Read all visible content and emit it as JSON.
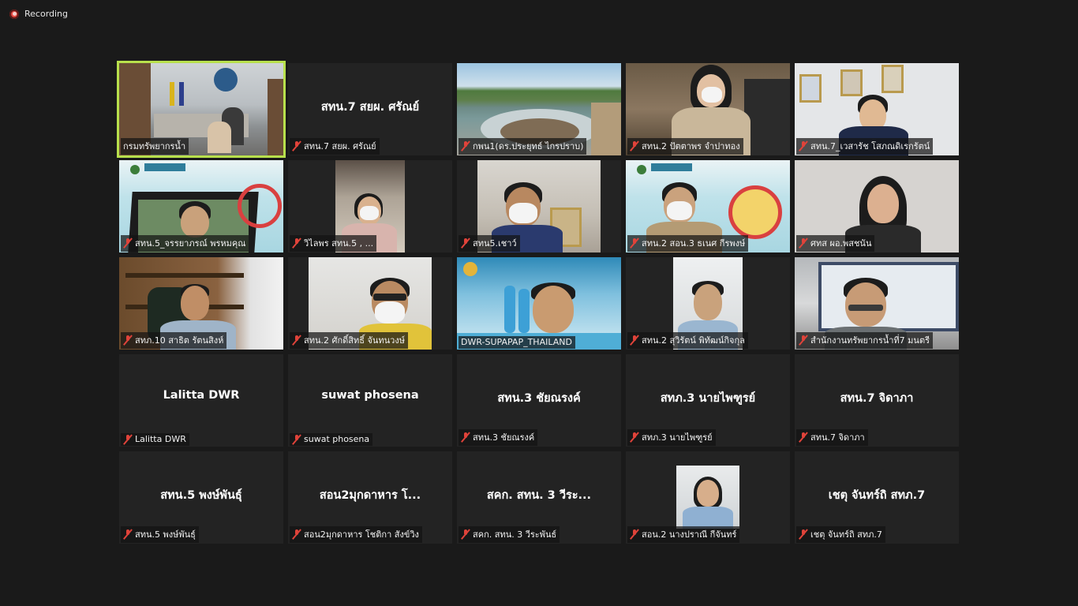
{
  "recording": {
    "label": "Recording"
  },
  "participants": [
    {
      "name": "กรมทรัพยากรน้ำ",
      "display": "",
      "video": true,
      "muted": false,
      "active": true
    },
    {
      "name": "สทน.7 สยผ. ศรัณย์",
      "display": "สทน.7 สยผ. ศรัณย์",
      "video": false,
      "muted": true
    },
    {
      "name": "กพน1(ดร.ประยุทธ์  ไกรปราบ)",
      "display": "",
      "video": true,
      "muted": true
    },
    {
      "name": "สทน.2 ปัตตาพร  จำปาทอง",
      "display": "",
      "video": true,
      "muted": true
    },
    {
      "name": "สทน.7_เวสารัช โสภณดิเรกรัตน์",
      "display": "",
      "video": true,
      "muted": true
    },
    {
      "name": "สทน.5_จรรยาภรณ์ พรหมคุณ",
      "display": "",
      "video": true,
      "muted": true
    },
    {
      "name": "วิไลพร สทน.5 , ...",
      "display": "",
      "video": true,
      "muted": true
    },
    {
      "name": "สทน5.เชาว์",
      "display": "",
      "video": true,
      "muted": true
    },
    {
      "name": "สทน.2 สอน.3 ธเนศ กีรพงษ์",
      "display": "",
      "video": true,
      "muted": true
    },
    {
      "name": "ศทส  ผอ.พสชนัน",
      "display": "",
      "video": true,
      "muted": true
    },
    {
      "name": "สทภ.10 สาธิต  รัตนสิงห์",
      "display": "",
      "video": true,
      "muted": true
    },
    {
      "name": "สทน.2 ศักดิ์สิทธิ์ จันทนวงษ์",
      "display": "",
      "video": true,
      "muted": true
    },
    {
      "name": "DWR-SUPAPAP_THAILAND",
      "display": "",
      "video": true,
      "muted": true
    },
    {
      "name": "สทน.2 สุวิรัตน์ พิทัฒน์กิจกุล",
      "display": "",
      "video": true,
      "muted": true
    },
    {
      "name": "สำนักงานทรัพยากรน้ำที่7 มนตรี",
      "display": "",
      "video": true,
      "muted": true
    },
    {
      "name": "Lalitta DWR",
      "display": "Lalitta DWR",
      "video": false,
      "muted": true
    },
    {
      "name": "suwat phosena",
      "display": "suwat phosena",
      "video": false,
      "muted": true
    },
    {
      "name": "สทน.3 ชัยณรงค์",
      "display": "สทน.3 ชัยณรงค์",
      "video": false,
      "muted": true
    },
    {
      "name": "สทภ.3 นายไพฑูรย์",
      "display": "สทภ.3 นายไพฑูรย์",
      "video": false,
      "muted": true
    },
    {
      "name": "สทน.7 จิดาภา",
      "display": "สทน.7 จิดาภา",
      "video": false,
      "muted": true
    },
    {
      "name": "สทน.5 พงษ์พันธุ์",
      "display": "สทน.5 พงษ์พันธุ์",
      "video": false,
      "muted": true
    },
    {
      "name": "สอน2มุกดาหาร โชติกา สังข์วิง",
      "display": "สอน2มุกดาหาร โ...",
      "video": false,
      "muted": true
    },
    {
      "name": "สคก. สทน. 3 วีระพันธ์",
      "display": "สคก. สทน. 3 วีระ...",
      "video": false,
      "muted": true
    },
    {
      "name": "สอน.2  นางปราณี กีจันทร์",
      "display": "",
      "video": true,
      "muted": true
    },
    {
      "name": "เชตุ จันทร์ถิ สทภ.7",
      "display": "เชตุ จันทร์ถิ สทภ.7",
      "video": false,
      "muted": true
    }
  ],
  "colors": {
    "background": "#1a1a1a",
    "tile": "#232323",
    "active_border": "#b8e04c",
    "mute": "#e0433a"
  }
}
